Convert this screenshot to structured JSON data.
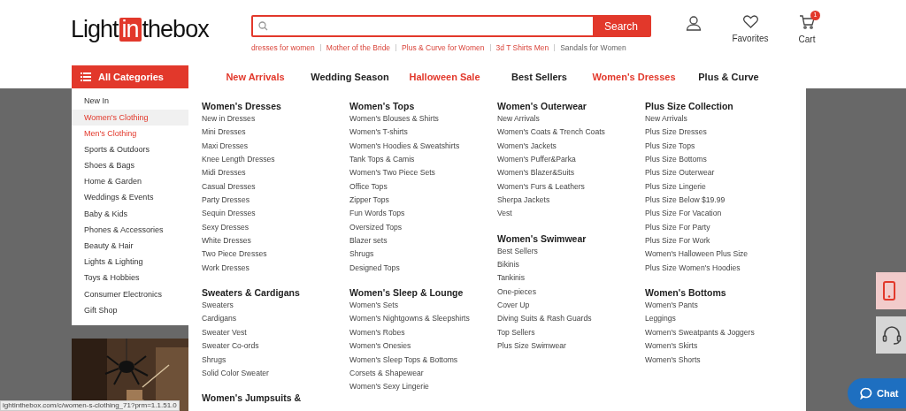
{
  "logo": {
    "before": "Light",
    "boxed": "in",
    "after": "thebox"
  },
  "search": {
    "button": "Search"
  },
  "suggestions": [
    {
      "label": "dresses for women",
      "highlighted": true
    },
    {
      "label": "Mother of the Bride",
      "highlighted": true
    },
    {
      "label": "Plus & Curve for Women",
      "highlighted": true
    },
    {
      "label": "3d T Shirts Men",
      "highlighted": true
    },
    {
      "label": "Sandals for Women",
      "highlighted": false
    }
  ],
  "account": [
    {
      "kind": "user"
    },
    {
      "kind": "heart",
      "label": "Favorites"
    },
    {
      "kind": "cart",
      "label": "Cart",
      "badge": "1"
    }
  ],
  "all_categories": "All Categories",
  "nav": [
    {
      "label": "New Arrivals",
      "highlighted": true
    },
    {
      "label": "Wedding Season",
      "highlighted": false
    },
    {
      "label": "Halloween Sale",
      "highlighted": true
    },
    {
      "label": "Best Sellers",
      "highlighted": false
    },
    {
      "label": "Women's Dresses",
      "highlighted": true
    },
    {
      "label": "Plus & Curve",
      "highlighted": false
    }
  ],
  "sidebar": [
    {
      "label": "New In",
      "selected": false,
      "highlighted": false
    },
    {
      "label": "Women's Clothing",
      "selected": true,
      "highlighted": true
    },
    {
      "label": "Men's Clothing",
      "selected": false,
      "highlighted": true
    },
    {
      "label": "Sports & Outdoors",
      "selected": false,
      "highlighted": false
    },
    {
      "label": "Shoes & Bags",
      "selected": false,
      "highlighted": false
    },
    {
      "label": "Home & Garden",
      "selected": false,
      "highlighted": false
    },
    {
      "label": "Weddings & Events",
      "selected": false,
      "highlighted": false
    },
    {
      "label": "Baby & Kids",
      "selected": false,
      "highlighted": false
    },
    {
      "label": "Phones & Accessories",
      "selected": false,
      "highlighted": false
    },
    {
      "label": "Beauty & Hair",
      "selected": false,
      "highlighted": false
    },
    {
      "label": "Lights & Lighting",
      "selected": false,
      "highlighted": false
    },
    {
      "label": "Toys & Hobbies",
      "selected": false,
      "highlighted": false
    },
    {
      "label": "Consumer Electronics",
      "selected": false,
      "highlighted": false
    },
    {
      "label": "Gift Shop",
      "selected": false,
      "highlighted": false
    }
  ],
  "menu_columns": [
    [
      {
        "title": "Women's Dresses",
        "items": [
          "New in Dresses",
          "Mini Dresses",
          "Maxi Dresses",
          "Knee Length Dresses",
          "Midi Dresses",
          "Casual Dresses",
          "Party Dresses",
          "Sequin Dresses",
          "Sexy Dresses",
          "White Dresses",
          "Two Piece Dresses",
          "Work Dresses"
        ]
      },
      {
        "title": "Sweaters & Cardigans",
        "items": [
          "Sweaters",
          "Cardigans",
          "Sweater Vest",
          "Sweater Co-ords",
          "Shrugs",
          "Solid Color Sweater"
        ]
      },
      {
        "title": "Women's Jumpsuits &"
      }
    ],
    [
      {
        "title": "Women's Tops",
        "items": [
          "Women's Blouses & Shirts",
          "Women's T-shirts",
          "Women's Hoodies & Sweatshirts",
          "Tank Tops & Camis",
          "Women's Two Piece Sets",
          "Office Tops",
          "Zipper Tops",
          "Fun Words Tops",
          "Oversized Tops",
          "Blazer sets",
          "Shrugs",
          "Designed Tops"
        ]
      },
      {
        "title": "Women's Sleep & Lounge",
        "items": [
          "Women's Sets",
          "Women's Nightgowns & Sleepshirts",
          "Women's Robes",
          "Women's Onesies",
          "Women's Sleep Tops & Bottoms",
          "Corsets & Shapewear",
          "Women's Sexy Lingerie"
        ]
      }
    ],
    [
      {
        "title": "Women's Outerwear",
        "items": [
          "New Arrivals",
          "Women's Coats & Trench Coats",
          "Women's Jackets",
          "Women's Puffer&Parka",
          "Women's Blazer&Suits",
          "Women's Furs & Leathers",
          "Sherpa Jackets",
          "Vest"
        ]
      },
      {
        "title": "Women's Swimwear",
        "items": [
          "Best Sellers",
          "Bikinis",
          "Tankinis",
          "One-pieces",
          "Cover Up",
          "Diving Suits & Rash Guards",
          "Top Sellers",
          "Plus Size Swimwear"
        ]
      }
    ],
    [
      {
        "title": "Plus Size Collection",
        "items": [
          "New Arrivals",
          "Plus Size Dresses",
          "Plus Size Tops",
          "Plus Size Bottoms",
          "Plus Size Outerwear",
          "Plus Size Lingerie",
          "Plus Size Below $19.99",
          "Plus Size For Vacation",
          "Plus Size For Party",
          "Plus Size For Work",
          "Women's Halloween Plus Size",
          "Plus Size Women's Hoodies"
        ]
      },
      {
        "title": "Women's Bottoms",
        "items": [
          "Women's Pants",
          "Leggings",
          "Women's Sweatpants & Joggers",
          "Women's Skirts",
          "Women's Shorts"
        ]
      }
    ]
  ],
  "side_widgets": [
    {
      "kind": "phone"
    },
    {
      "kind": "headset"
    }
  ],
  "chat": "Chat",
  "status_url": "ightinthebox.com/c/women-s-clothing_71?prm=1.1.51.0"
}
